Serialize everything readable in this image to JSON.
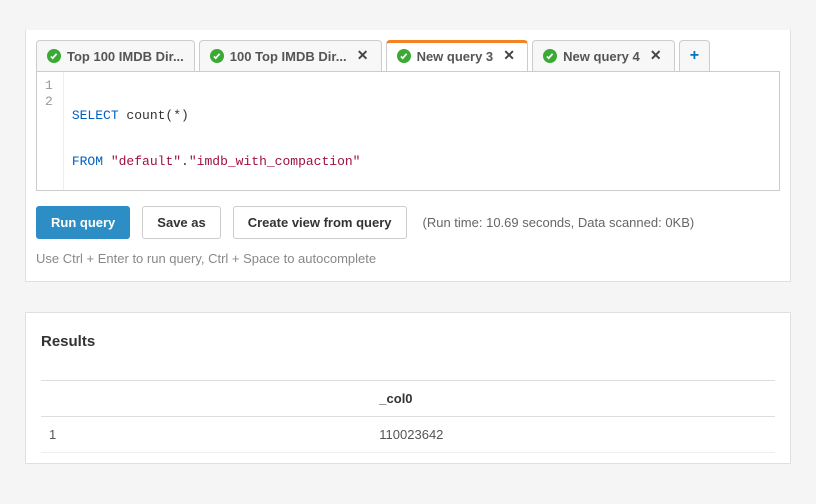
{
  "tabs": [
    {
      "label": "Top 100 IMDB Dir...",
      "closable": false,
      "active": false
    },
    {
      "label": "100 Top IMDB Dir...",
      "closable": true,
      "active": false
    },
    {
      "label": "New query 3",
      "closable": true,
      "active": true
    },
    {
      "label": "New query 4",
      "closable": true,
      "active": false
    }
  ],
  "editor": {
    "lines": [
      "1",
      "2"
    ],
    "line1": {
      "kw": "SELECT",
      "rest": " count(*)"
    },
    "line2": {
      "kw": "FROM",
      "s1": " \"default\"",
      "dot": ".",
      "s2": "\"imdb_with_compaction\""
    }
  },
  "buttons": {
    "run": "Run query",
    "save": "Save as",
    "create_view": "Create view from query"
  },
  "run_info": "(Run time: 10.69 seconds, Data scanned: 0KB)",
  "hint": "Use Ctrl + Enter to run query, Ctrl + Space to autocomplete",
  "results": {
    "heading": "Results",
    "columns": [
      "",
      "_col0"
    ],
    "rows": [
      {
        "n": "1",
        "v": "110023642"
      }
    ]
  },
  "chart_data": {
    "type": "table",
    "title": "Results",
    "columns": [
      "_col0"
    ],
    "rows": [
      [
        110023642
      ]
    ]
  }
}
